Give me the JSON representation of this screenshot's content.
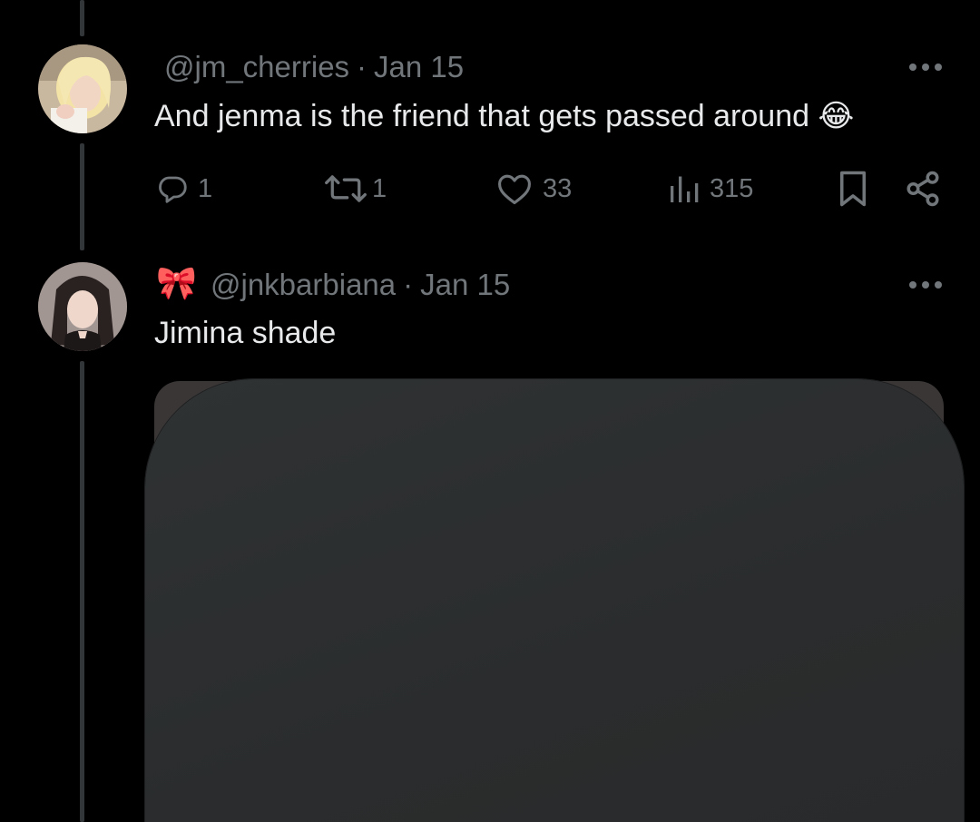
{
  "tweets": [
    {
      "handle": "@jm_cherries",
      "separator": "·",
      "date": "Jan 15",
      "text": "And jenma is the friend that gets passed around 😂",
      "stats": {
        "replies": "1",
        "reposts": "1",
        "likes": "33",
        "views": "315"
      }
    },
    {
      "name_emoji": "🎀",
      "handle": "@jnkbarbiana",
      "separator": "·",
      "date": "Jan 15",
      "text": "Jimina shade"
    }
  ],
  "colors": {
    "background": "#000000",
    "text_primary": "#e7e9ea",
    "text_secondary": "#71767b",
    "thread_line": "#333639",
    "media_placeholder": "#2e3132"
  },
  "icons": {
    "reply": "reply-icon",
    "repost": "repost-icon",
    "like": "heart-icon",
    "views": "views-icon",
    "bookmark": "bookmark-icon",
    "share": "share-icon",
    "more": "more-icon"
  }
}
